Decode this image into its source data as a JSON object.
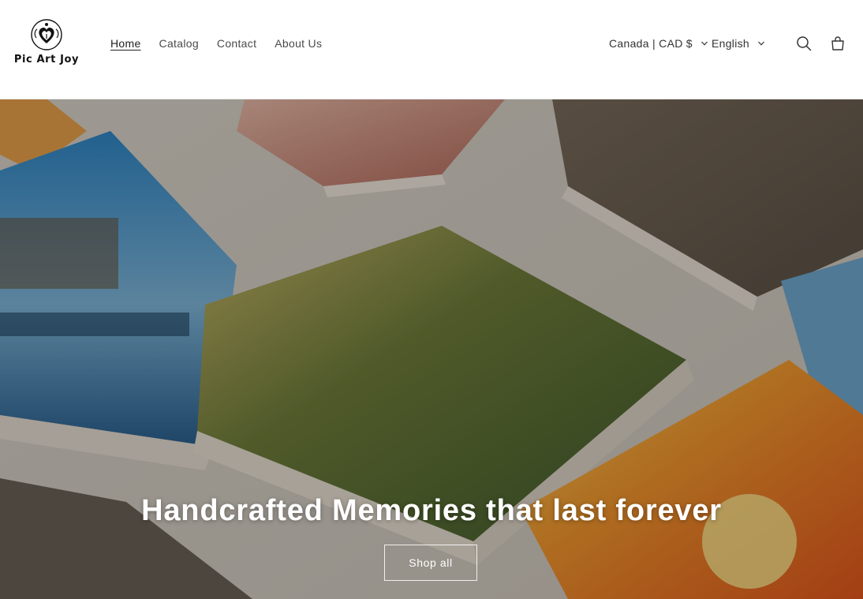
{
  "brand": {
    "logo_text": "Pic Art Joy"
  },
  "nav": {
    "items": [
      {
        "label": "Home",
        "active": true
      },
      {
        "label": "Catalog",
        "active": false
      },
      {
        "label": "Contact",
        "active": false
      },
      {
        "label": "About Us",
        "active": false
      }
    ]
  },
  "localization": {
    "country_value": "Canada | CAD $",
    "language_value": "English"
  },
  "icons": {
    "search": "search-icon",
    "cart": "cart-icon",
    "chevron": "chevron-down-icon"
  },
  "hero": {
    "headline": "Handcrafted Memories that last forever",
    "cta_label": "Shop all"
  },
  "colors": {
    "header_bg": "#ffffff",
    "text": "#222222",
    "hero_text": "#ffffff"
  }
}
